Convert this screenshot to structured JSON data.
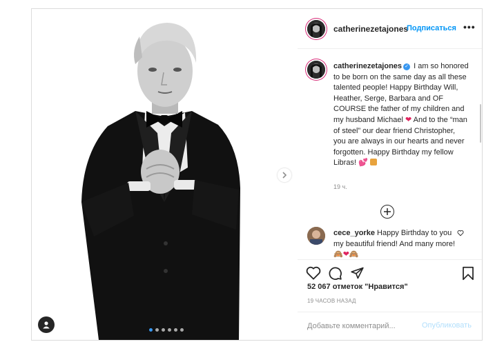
{
  "post": {
    "author": "catherinezetajones",
    "follow_label": "Подписаться",
    "more_label": "•••",
    "caption": {
      "username": "catherinezetajones",
      "text_1": "I am so honored to be born on the same day as all these talented people! Happy Birthday Will, Heather, Serge, Barbara and OF COURSE the father of my children and my husband Michael",
      "text_2": "And to the “man of steel” our dear friend Christopher, you are always in our hearts and never forgotten. Happy Birthday my fellow Libras!",
      "time": "19 ч."
    },
    "comment": {
      "username": "cece_yorke",
      "text": "Happy Birthday to you my beautiful friend! And many more!"
    },
    "likes": "52 067 отметок \"Нравится\"",
    "posted_ago": "19 ЧАСОВ НАЗАД",
    "add_comment_placeholder": "Добавьте комментарий...",
    "publish_label": "Опубликовать",
    "carousel": {
      "count": 6,
      "active_index": 0
    },
    "colors": {
      "accent": "#0095f6",
      "story_ring": "#d62976",
      "heart": "#e0245e"
    },
    "icons": [
      "chevron-right-icon",
      "user-tag-icon",
      "verified-icon",
      "add-comment-icon",
      "heart-icon",
      "comment-icon",
      "share-icon",
      "bookmark-icon"
    ]
  }
}
